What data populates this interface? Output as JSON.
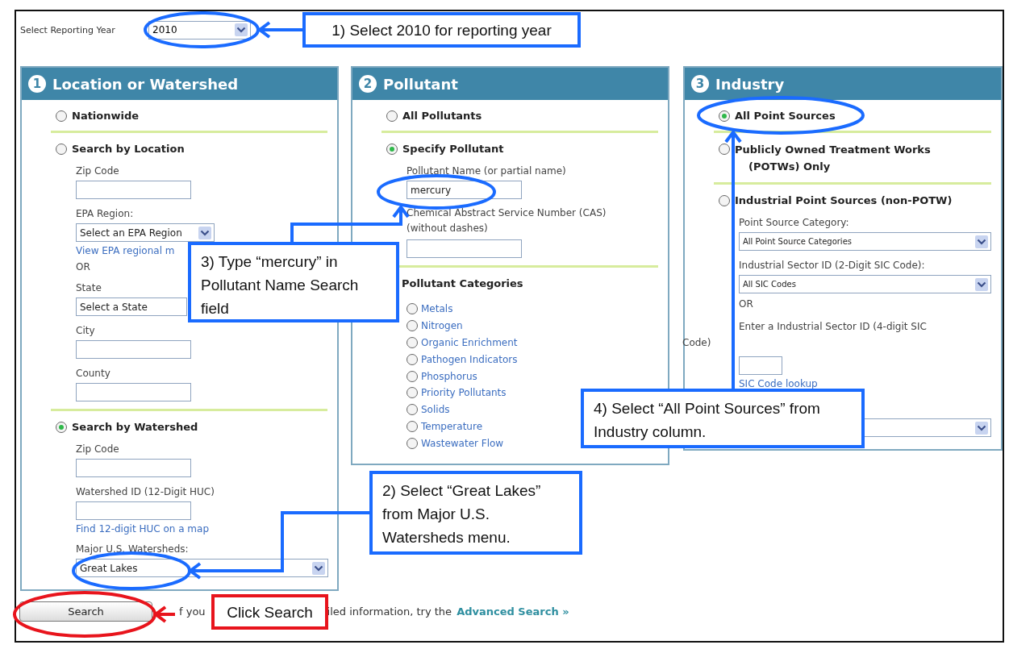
{
  "reporting_year": {
    "label": "Select Reporting Year",
    "value": "2010"
  },
  "panels": [
    {
      "number": "1",
      "title": "Location or Watershed",
      "items": [
        {
          "kind": "radio",
          "label": "Nationwide",
          "selected": false
        },
        {
          "kind": "divider"
        },
        {
          "kind": "radio",
          "label": "Search by Location",
          "selected": false
        },
        {
          "kind": "field",
          "label": "Zip Code"
        },
        {
          "kind": "select",
          "label": "EPA Region:",
          "value": "Select an EPA Region"
        },
        {
          "kind": "link",
          "text": "View EPA regional m"
        },
        {
          "kind": "text",
          "text": "OR"
        },
        {
          "kind": "select",
          "label": "State",
          "value": "Select a State"
        },
        {
          "kind": "field",
          "label": "City"
        },
        {
          "kind": "field",
          "label": "County"
        },
        {
          "kind": "divider"
        },
        {
          "kind": "radio",
          "label": "Search by Watershed",
          "selected": true
        },
        {
          "kind": "field",
          "label": "Zip Code"
        },
        {
          "kind": "field",
          "label": "Watershed ID (12-Digit HUC)"
        },
        {
          "kind": "link",
          "text": "Find 12-digit HUC on a map"
        },
        {
          "kind": "wide_select",
          "label": "Major U.S. Watersheds:",
          "value": "Great Lakes"
        }
      ]
    },
    {
      "number": "2",
      "title": "Pollutant",
      "items": [
        {
          "kind": "radio",
          "label": "All Pollutants",
          "selected": false
        },
        {
          "kind": "divider"
        },
        {
          "kind": "radio",
          "label": "Specify Pollutant",
          "selected": true
        },
        {
          "kind": "field",
          "label": "Pollutant Name (or partial name)",
          "value": "mercury"
        },
        {
          "kind": "field",
          "label": "Chemical Abstract Service Number (CAS) (without dashes)"
        },
        {
          "kind": "divider"
        },
        {
          "kind": "heading",
          "text": "Pollutant Categories"
        },
        {
          "kind": "option",
          "label": "Metals",
          "selected": false
        },
        {
          "kind": "option",
          "label": "Nitrogen",
          "selected": false
        },
        {
          "kind": "option",
          "label": "Organic Enrichment",
          "selected": false
        },
        {
          "kind": "option",
          "label": "Pathogen Indicators",
          "selected": false
        },
        {
          "kind": "option",
          "label": "Phosphorus",
          "selected": false
        },
        {
          "kind": "option",
          "label": "Priority Pollutants",
          "selected": false
        },
        {
          "kind": "option",
          "label": "Solids",
          "selected": false
        },
        {
          "kind": "option",
          "label": "Temperature",
          "selected": false
        },
        {
          "kind": "option",
          "label": "Wastewater Flow",
          "selected": false
        }
      ]
    },
    {
      "number": "3",
      "title": "Industry",
      "items": [
        {
          "kind": "radio",
          "label": "All Point Sources",
          "selected": true
        },
        {
          "kind": "divider"
        },
        {
          "kind": "radio",
          "label": "Publicly Owned Treatment Works (POTWs) Only",
          "selected": false
        },
        {
          "kind": "divider"
        },
        {
          "kind": "radio",
          "label": "Industrial Point Sources (non-POTW)",
          "selected": false
        },
        {
          "kind": "wide_select",
          "label": "Point Source Category:",
          "value": "All Point Source Categories"
        },
        {
          "kind": "wide_select",
          "label": "Industrial Sector ID (2-Digit SIC Code):",
          "value": "All SIC Codes"
        },
        {
          "kind": "text",
          "text": "OR"
        },
        {
          "kind": "text",
          "text": "Enter a Industrial Sector ID (4-digit SIC"
        },
        {
          "kind": "outdent",
          "text": "Code)"
        },
        {
          "kind": "short_field"
        },
        {
          "kind": "link",
          "text": "SIC Code lookup"
        },
        {
          "kind": "wide_select"
        }
      ]
    }
  ],
  "footer": {
    "button": "Search",
    "text_before": "f you",
    "text_after": "iled information, try the",
    "link": "Advanced Search »"
  },
  "callouts": [
    {
      "text": "1) Select 2010 for reporting year",
      "color": "#1a6bff"
    },
    {
      "text": "2) Select “Great Lakes” from Major U.S. Watersheds menu.",
      "color": "#1a6bff"
    },
    {
      "text": "3) Type “mercury” in Pollutant Name Search field",
      "color": "#1a6bff"
    },
    {
      "text": "4) Select “All Point Sources” from Industry column.",
      "color": "#1a6bff"
    },
    {
      "text": "Click Search",
      "color": "#e8141c"
    }
  ]
}
